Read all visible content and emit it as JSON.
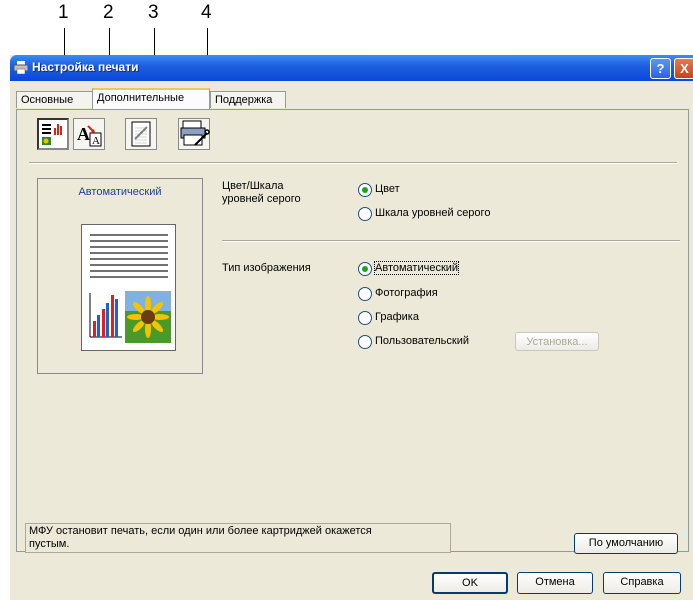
{
  "callouts": [
    "1",
    "2",
    "3",
    "4"
  ],
  "window": {
    "title": "Настройка печати",
    "help_button": "?",
    "close_button": "X"
  },
  "tabs": [
    {
      "label": "Основные",
      "active": false
    },
    {
      "label": "Дополнительные",
      "active": true
    },
    {
      "label": "Поддержка",
      "active": false
    }
  ],
  "toolbar": {
    "icons": [
      "color-settings-icon",
      "font-scaling-icon",
      "watermark-icon",
      "device-options-icon"
    ]
  },
  "preview": {
    "label": "Автоматический"
  },
  "color": {
    "group_label_line1": "Цвет/Шкала",
    "group_label_line2": "уровней серого",
    "options": [
      {
        "label": "Цвет",
        "selected": true
      },
      {
        "label": "Шкала уровней серого",
        "selected": false
      }
    ]
  },
  "image_type": {
    "group_label": "Тип изображения",
    "options": [
      {
        "label": "Автоматический",
        "selected": true
      },
      {
        "label": "Фотография",
        "selected": false
      },
      {
        "label": "Графика",
        "selected": false
      },
      {
        "label": "Пользовательский",
        "selected": false
      }
    ],
    "setup_button": "Установка..."
  },
  "status_text_line1": "МФУ остановит печать, если один или более картриджей окажется",
  "status_text_line2": "пустым.",
  "default_button": "По умолчанию",
  "buttons": {
    "ok": "OK",
    "cancel": "Отмена",
    "help": "Справка"
  },
  "colors": {
    "titlebar": "#0a48d6",
    "dialog_bg": "#ece9d8",
    "radio_dot": "#21a121",
    "accent_text": "#1e3f99"
  }
}
